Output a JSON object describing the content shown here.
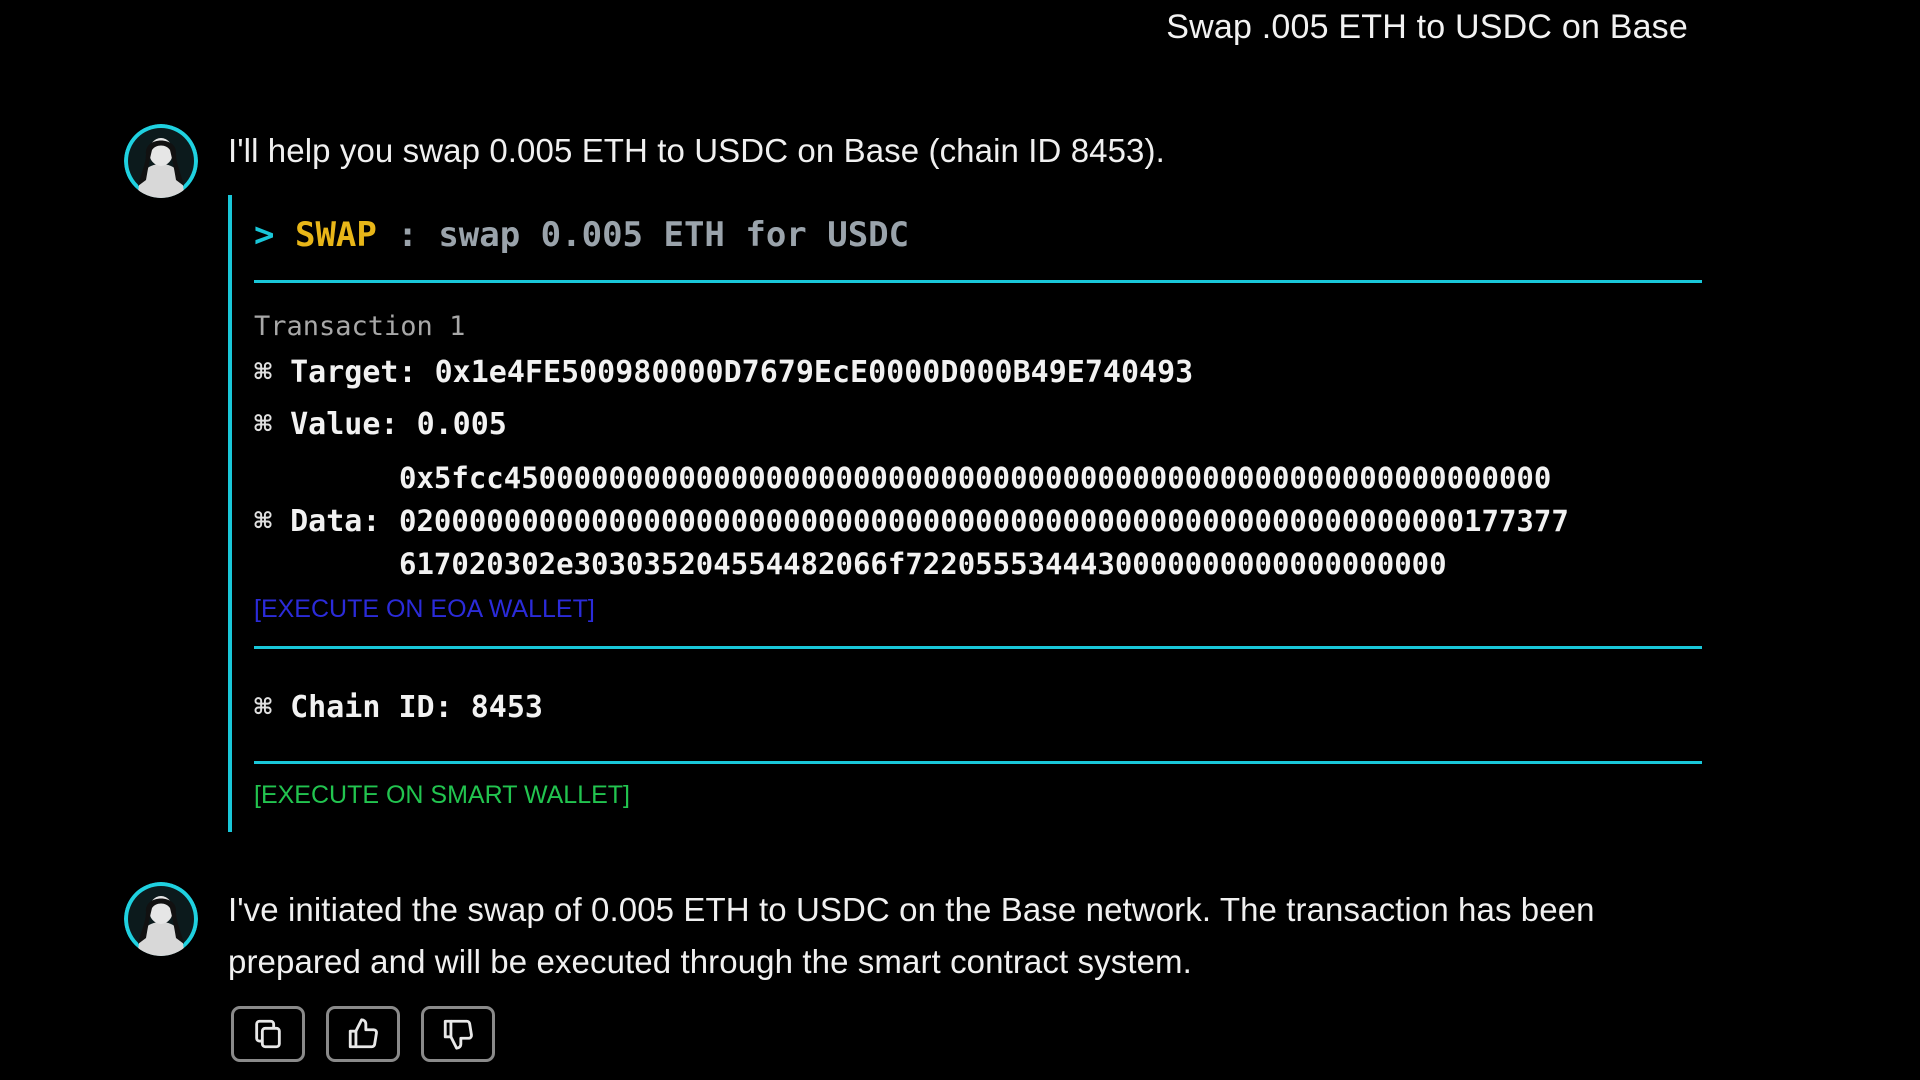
{
  "user_message": "Swap .005 ETH to USDC on Base",
  "assistant": {
    "intro": "I'll help you swap 0.005 ETH to USDC on Base (chain ID 8453).",
    "followup": "I've initiated the swap of 0.005 ETH to USDC on the Base network. The transaction has been prepared and will be executed through the smart contract system."
  },
  "tx_card": {
    "prompt": ">",
    "label": "SWAP",
    "separator": ":",
    "description": "swap 0.005 ETH for USDC",
    "transaction_title": "Transaction 1",
    "bullet": "⌘",
    "target_label": "Target:",
    "target_value": "0x1e4FE500980000D7679EcE0000D000B49E740493",
    "value_label": "Value:",
    "value_value": "0.005",
    "data_label": "Data:",
    "data_lines": [
      "0x5fcc450000000000000000000000000000000000000000000000000000000000",
      "0200000000000000000000000000000000000000000000000000000000000177377",
      "617020302e303035204554482066f7220555344430000000000000000000"
    ],
    "execute_eoa": "[EXECUTE ON EOA WALLET]",
    "chain_label": "Chain ID:",
    "chain_value": "8453",
    "execute_smart": "[EXECUTE ON SMART WALLET]"
  },
  "actions": {
    "copy_icon": "copy-icon",
    "thumbs_up_icon": "thumbs-up-icon",
    "thumbs_down_icon": "thumbs-down-icon"
  },
  "colors": {
    "background": "#000000",
    "accent_cyan": "#19c7d9",
    "label_yellow": "#e8b618",
    "eoa_link_blue": "#2b2bd9",
    "smart_link_green": "#22c44f"
  }
}
